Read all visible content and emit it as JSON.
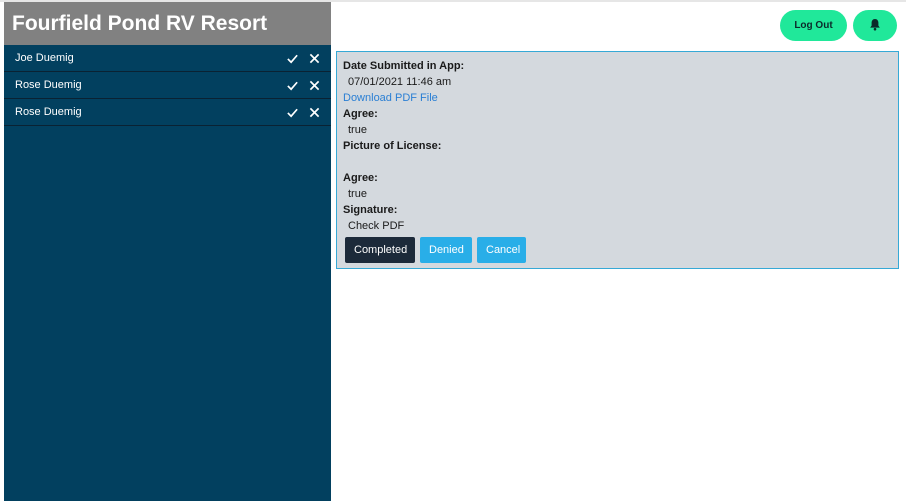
{
  "app": {
    "title": "Fourfield Pond RV Resort"
  },
  "header": {
    "logout_label": "Log Out",
    "bell_icon": "bell-icon"
  },
  "sidebar": {
    "items": [
      {
        "name": "Joe Duemig",
        "approve_icon": "check-icon",
        "reject_icon": "close-icon"
      },
      {
        "name": "Rose Duemig",
        "approve_icon": "check-icon",
        "reject_icon": "close-icon"
      },
      {
        "name": "Rose Duemig",
        "approve_icon": "check-icon",
        "reject_icon": "close-icon"
      }
    ]
  },
  "detail": {
    "date_label": "Date Submitted in App:",
    "date_value": "07/01/2021 11:46 am",
    "download_link": "Download PDF File",
    "agree1_label": "Agree:",
    "agree1_value": "true",
    "license_label": "Picture of License:",
    "agree2_label": "Agree:",
    "agree2_value": "true",
    "signature_label": "Signature:",
    "signature_value": "Check PDF"
  },
  "actions": {
    "completed": "Completed",
    "denied": "Denied",
    "cancel": "Cancel"
  },
  "colors": {
    "sidebar_bg": "#02405f",
    "header_bg": "#818181",
    "accent_green": "#20e89a",
    "button_blue": "#29aee8",
    "button_dark": "#1c2a3a"
  }
}
